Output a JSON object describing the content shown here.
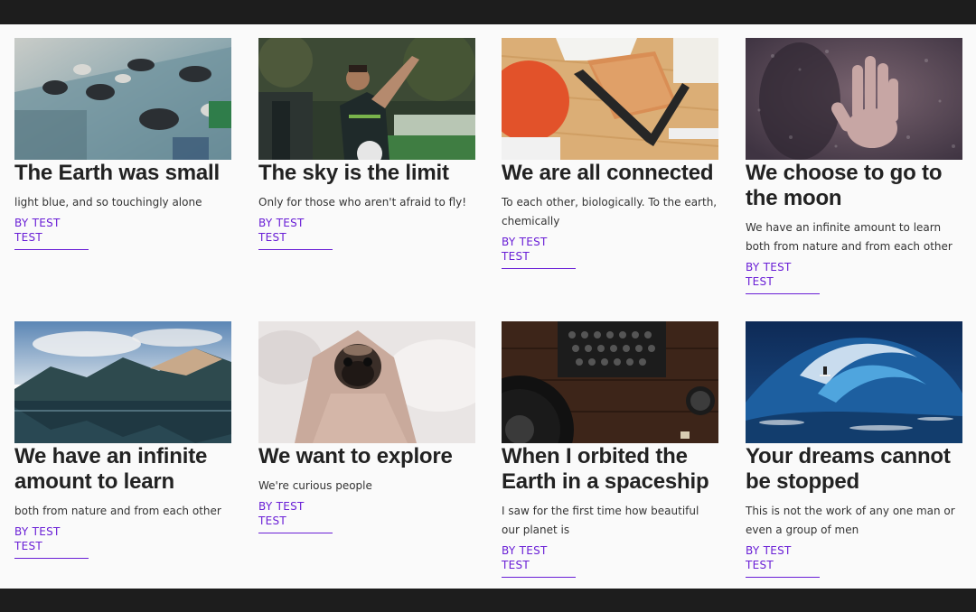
{
  "colors": {
    "bar": "#1d1d1d",
    "background": "#fafafa",
    "accent": "#6a1fd6",
    "title": "#222222"
  },
  "cards": [
    {
      "title": "The Earth was small",
      "description": "light blue, and so touchingly alone",
      "author": "BY TEST TEST",
      "image": "toy-cars-photo"
    },
    {
      "title": "The sky is the limit",
      "description": "Only for those who aren't afraid to fly!",
      "author": "BY TEST TEST",
      "image": "soccer-player-photo"
    },
    {
      "title": "We are all connected",
      "description": "To each other, biologically. To the earth, chemically",
      "author": "BY TEST TEST",
      "image": "desk-notebook-photo"
    },
    {
      "title": "We choose to go to the moon",
      "description": "We have an infinite amount to learn both from nature and from each other",
      "author": "BY TEST TEST",
      "image": "hand-on-wet-glass-photo"
    },
    {
      "title": "We have an infinite amount to learn",
      "description": "both from nature and from each other",
      "author": "BY TEST TEST",
      "image": "mountain-lake-photo"
    },
    {
      "title": "We want to explore",
      "description": "We're curious people",
      "author": "BY TEST TEST",
      "image": "pug-blanket-photo"
    },
    {
      "title": "When I orbited the Earth in a spaceship",
      "description": "I saw for the first time how beautiful our planet is",
      "author": "BY TEST TEST",
      "image": "typewriter-record-photo"
    },
    {
      "title": "Your dreams cannot be stopped",
      "description": "This is not the work of any one man or even a group of men",
      "author": "BY TEST TEST",
      "image": "surfer-wave-photo"
    }
  ]
}
